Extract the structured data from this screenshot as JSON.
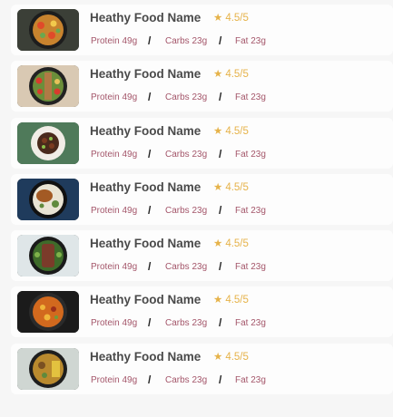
{
  "items": [
    {
      "name": "Heathy Food Name",
      "rating": "4.5/5",
      "protein": "Protein 49g",
      "carbs": "Carbs 23g",
      "fat": "Fat 23g",
      "sep": "/"
    },
    {
      "name": "Heathy Food Name",
      "rating": "4.5/5",
      "protein": "Protein 49g",
      "carbs": "Carbs 23g",
      "fat": "Fat 23g",
      "sep": "/"
    },
    {
      "name": "Heathy Food Name",
      "rating": "4.5/5",
      "protein": "Protein 49g",
      "carbs": "Carbs 23g",
      "fat": "Fat 23g",
      "sep": "/"
    },
    {
      "name": "Heathy Food Name",
      "rating": "4.5/5",
      "protein": "Protein 49g",
      "carbs": "Carbs 23g",
      "fat": "Fat 23g",
      "sep": "/"
    },
    {
      "name": "Heathy Food Name",
      "rating": "4.5/5",
      "protein": "Protein 49g",
      "carbs": "Carbs 23g",
      "fat": "Fat 23g",
      "sep": "/"
    },
    {
      "name": "Heathy Food Name",
      "rating": "4.5/5",
      "protein": "Protein 49g",
      "carbs": "Carbs 23g",
      "fat": "Fat 23g",
      "sep": "/"
    },
    {
      "name": "Heathy Food Name",
      "rating": "4.5/5",
      "protein": "Protein 49g",
      "carbs": "Carbs 23g",
      "fat": "Fat 23g",
      "sep": "/"
    }
  ],
  "star_icon": "star-icon",
  "colors": {
    "rating": "#e6b34a",
    "macro": "#a4566a",
    "title": "#4a4a4a"
  }
}
